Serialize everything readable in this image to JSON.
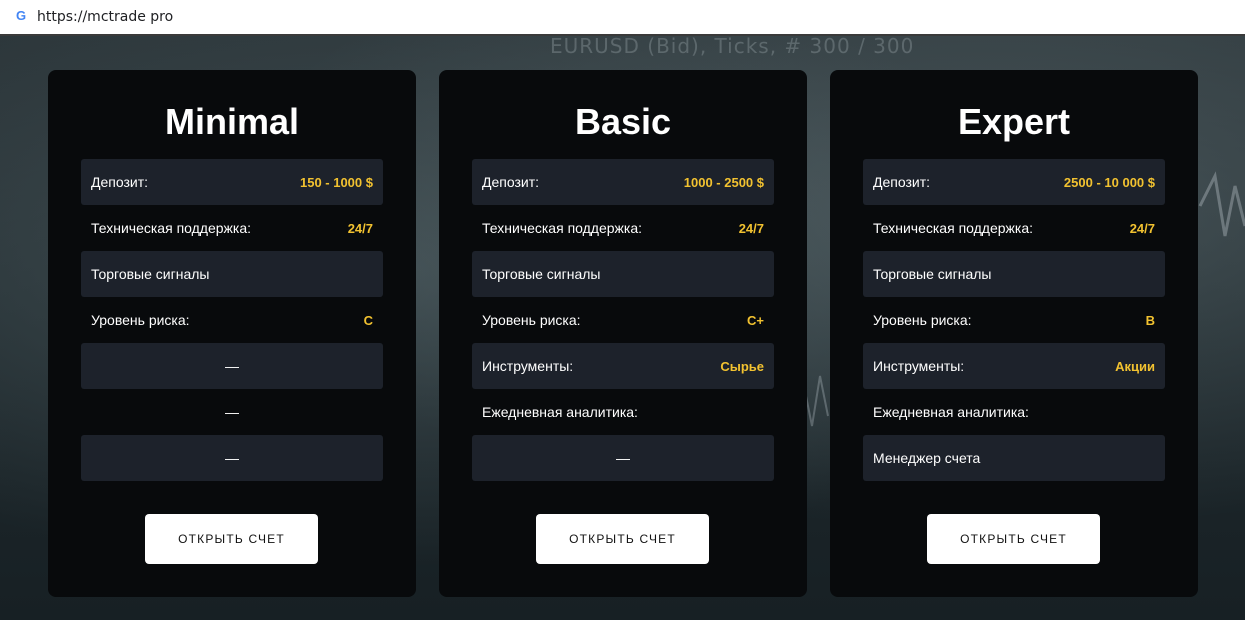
{
  "browser": {
    "url": "https://mctrade pro"
  },
  "background": {
    "ghost_text": "EURUSD (Bid), Ticks, # 300 / 300"
  },
  "plans": [
    {
      "name": "Minimal",
      "rows": [
        {
          "label": "Депозит:",
          "value": "150 - 1000 $"
        },
        {
          "label": "Техническая поддержка:",
          "value": "24/7"
        },
        {
          "label": "Торговые сигналы",
          "value": ""
        },
        {
          "label": "Уровень риска:",
          "value": "C"
        },
        {
          "label": "—",
          "value": ""
        },
        {
          "label": "—",
          "value": ""
        },
        {
          "label": "—",
          "value": ""
        }
      ],
      "button": "ОТКРЫТЬ СЧЕТ"
    },
    {
      "name": "Basic",
      "rows": [
        {
          "label": "Депозит:",
          "value": "1000 - 2500 $"
        },
        {
          "label": "Техническая поддержка:",
          "value": "24/7"
        },
        {
          "label": "Торговые сигналы",
          "value": ""
        },
        {
          "label": "Уровень риска:",
          "value": "C+"
        },
        {
          "label": "Инструменты:",
          "value": "Сырье"
        },
        {
          "label": "Ежедневная аналитика:",
          "value": ""
        },
        {
          "label": "—",
          "value": ""
        }
      ],
      "button": "ОТКРЫТЬ СЧЕТ"
    },
    {
      "name": "Expert",
      "rows": [
        {
          "label": "Депозит:",
          "value": "2500 - 10 000 $"
        },
        {
          "label": "Техническая поддержка:",
          "value": "24/7"
        },
        {
          "label": "Торговые сигналы",
          "value": ""
        },
        {
          "label": "Уровень риска:",
          "value": "B"
        },
        {
          "label": "Инструменты:",
          "value": "Акции"
        },
        {
          "label": "Ежедневная аналитика:",
          "value": ""
        },
        {
          "label": "Менеджер счета",
          "value": ""
        }
      ],
      "button": "ОТКРЫТЬ СЧЕТ"
    }
  ],
  "colors": {
    "accent": "#f2c230",
    "card": "#080a0c",
    "row_shaded": "#1d222b"
  }
}
